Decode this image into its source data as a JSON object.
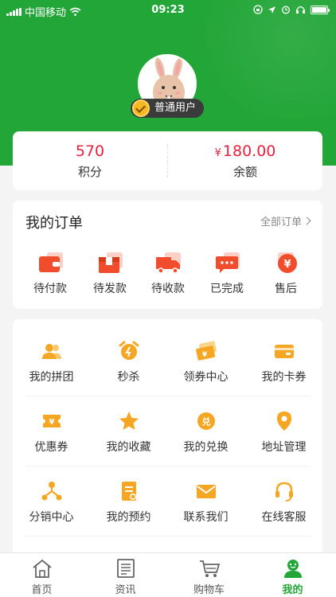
{
  "status_bar": {
    "carrier": "中国移动",
    "time": "09:23"
  },
  "profile": {
    "user_type": "普通用户"
  },
  "stats": [
    {
      "value": "570",
      "label": "积分"
    },
    {
      "currency": "¥",
      "value": "180.00",
      "label": "余额"
    }
  ],
  "orders": {
    "title": "我的订单",
    "all_label": "全部订单",
    "items": [
      {
        "label": "待付款",
        "icon": "wallet-icon"
      },
      {
        "label": "待发款",
        "icon": "package-icon"
      },
      {
        "label": "待收款",
        "icon": "truck-icon"
      },
      {
        "label": "已完成",
        "icon": "chat-done-icon"
      },
      {
        "label": "售后",
        "icon": "yen-circle-icon"
      }
    ]
  },
  "services": [
    {
      "label": "我的拼团",
      "icon": "group-users-icon"
    },
    {
      "label": "秒杀",
      "icon": "alarm-clock-icon"
    },
    {
      "label": "领券中心",
      "icon": "ticket-icon"
    },
    {
      "label": "我的卡券",
      "icon": "card-icon"
    },
    {
      "label": "优惠券",
      "icon": "coupon-icon"
    },
    {
      "label": "我的收藏",
      "icon": "star-icon"
    },
    {
      "label": "我的兑换",
      "icon": "exchange-icon"
    },
    {
      "label": "地址管理",
      "icon": "location-pin-icon"
    },
    {
      "label": "分销中心",
      "icon": "network-icon"
    },
    {
      "label": "我的预约",
      "icon": "appointment-icon"
    },
    {
      "label": "联系我们",
      "icon": "mail-icon"
    },
    {
      "label": "在线客服",
      "icon": "headset-icon"
    }
  ],
  "tabs": [
    {
      "label": "首页",
      "icon": "home-icon"
    },
    {
      "label": "资讯",
      "icon": "news-icon"
    },
    {
      "label": "购物车",
      "icon": "cart-icon"
    },
    {
      "label": "我的",
      "icon": "user-icon",
      "active": true
    }
  ],
  "colors": {
    "brand_green": "#23a638",
    "accent_red": "#e8233f",
    "icon_orange": "#f5a623",
    "order_red": "#f04d2d"
  }
}
